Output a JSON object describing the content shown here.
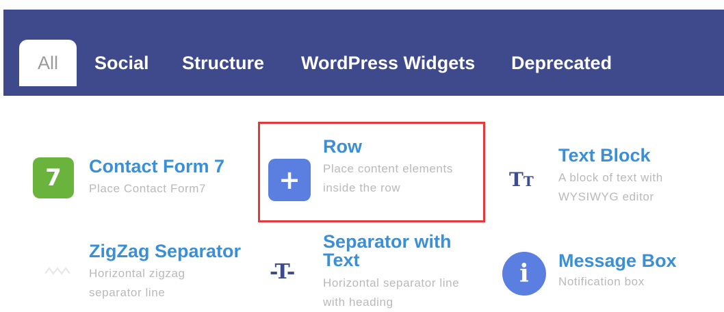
{
  "tabs": [
    {
      "label": "All",
      "active": true
    },
    {
      "label": "Social",
      "active": false
    },
    {
      "label": "Structure",
      "active": false
    },
    {
      "label": "WordPress Widgets",
      "active": false
    },
    {
      "label": "Deprecated",
      "active": false
    }
  ],
  "elements": {
    "contact_form": {
      "icon_text": "7",
      "title": "Contact Form 7",
      "description": "Place Contact Form7",
      "icon_color": "#6ab43e"
    },
    "row": {
      "icon_text": "+",
      "title": "Row",
      "description": "Place content elements inside the row",
      "icon_color": "#5b7fe0",
      "highlighted": true
    },
    "text_block": {
      "icon_text": "TT",
      "title": "Text Block",
      "description": "A block of text with WYSIWYG editor",
      "icon_color": "#3d4c8f"
    },
    "zigzag": {
      "title": "ZigZag Separator",
      "description": "Horizontal zigzag separator line"
    },
    "separator_text": {
      "icon_text": "-T-",
      "title": "Separator with Text",
      "description": "Horizontal separator line with heading",
      "icon_color": "#3d4c8f"
    },
    "message_box": {
      "icon_text": "i",
      "title": "Message Box",
      "description": "Notification box",
      "icon_color": "#5b7fe0"
    }
  },
  "colors": {
    "tab_bar": "#3e4a8c",
    "highlight_border": "#e23a3a",
    "title": "#3b8fd6",
    "description": "#b9b9b9"
  }
}
